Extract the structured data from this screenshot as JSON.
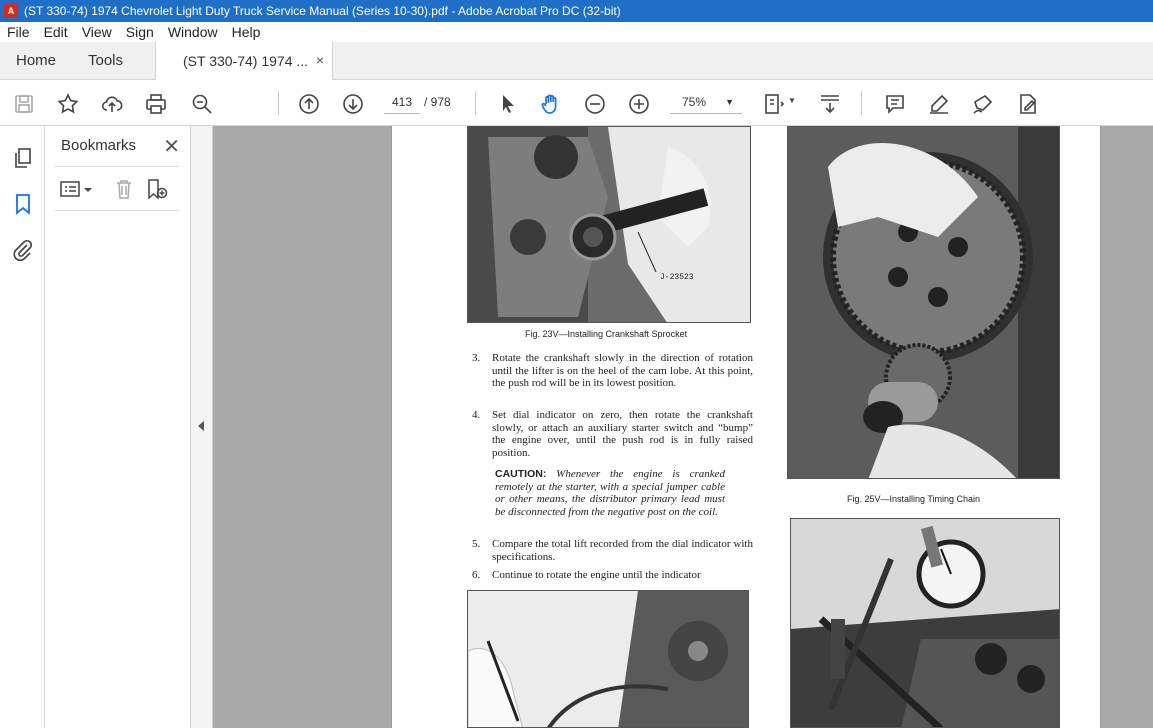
{
  "window": {
    "title": "(ST 330-74) 1974 Chevrolet Light Duty Truck Service Manual (Series 10-30).pdf - Adobe Acrobat Pro DC (32-bit)"
  },
  "menu": [
    "File",
    "Edit",
    "View",
    "Sign",
    "Window",
    "Help"
  ],
  "tabs": {
    "home": "Home",
    "tools": "Tools",
    "document": "(ST 330-74) 1974 ...",
    "close": "×"
  },
  "toolbar": {
    "page_current": "413",
    "page_total": "/ 978",
    "zoom": "75%",
    "zoom_arrow": "▼"
  },
  "bookmarks": {
    "title": "Bookmarks",
    "close": "✕"
  },
  "document": {
    "fig23_label": "J-23523",
    "fig23_caption": "Fig. 23V—Installing Crankshaft Sprocket",
    "fig25_caption": "Fig. 25V—Installing Timing Chain",
    "steps": [
      {
        "num": "3.",
        "text": "Rotate the crankshaft slowly in the direction of rotation until the lifter is on the heel of the cam lobe. At this point, the push rod will be in its lowest position."
      },
      {
        "num": "4.",
        "text": "Set dial indicator on zero, then rotate the crankshaft slowly, or attach an auxiliary starter switch and “bump” the engine over, until the push rod is in fully raised position."
      },
      {
        "num": "5.",
        "text": "Compare the total lift recorded from the dial indicator with specifications."
      },
      {
        "num": "6.",
        "text": "Continue to rotate the engine until the indicator"
      }
    ],
    "caution_label": "CAUTION:",
    "caution_text": "Whenever the engine is cranked remotely at the starter, with a special jumper cable or other means, the distributor primary lead must be disconnected from the negative post on the coil."
  }
}
